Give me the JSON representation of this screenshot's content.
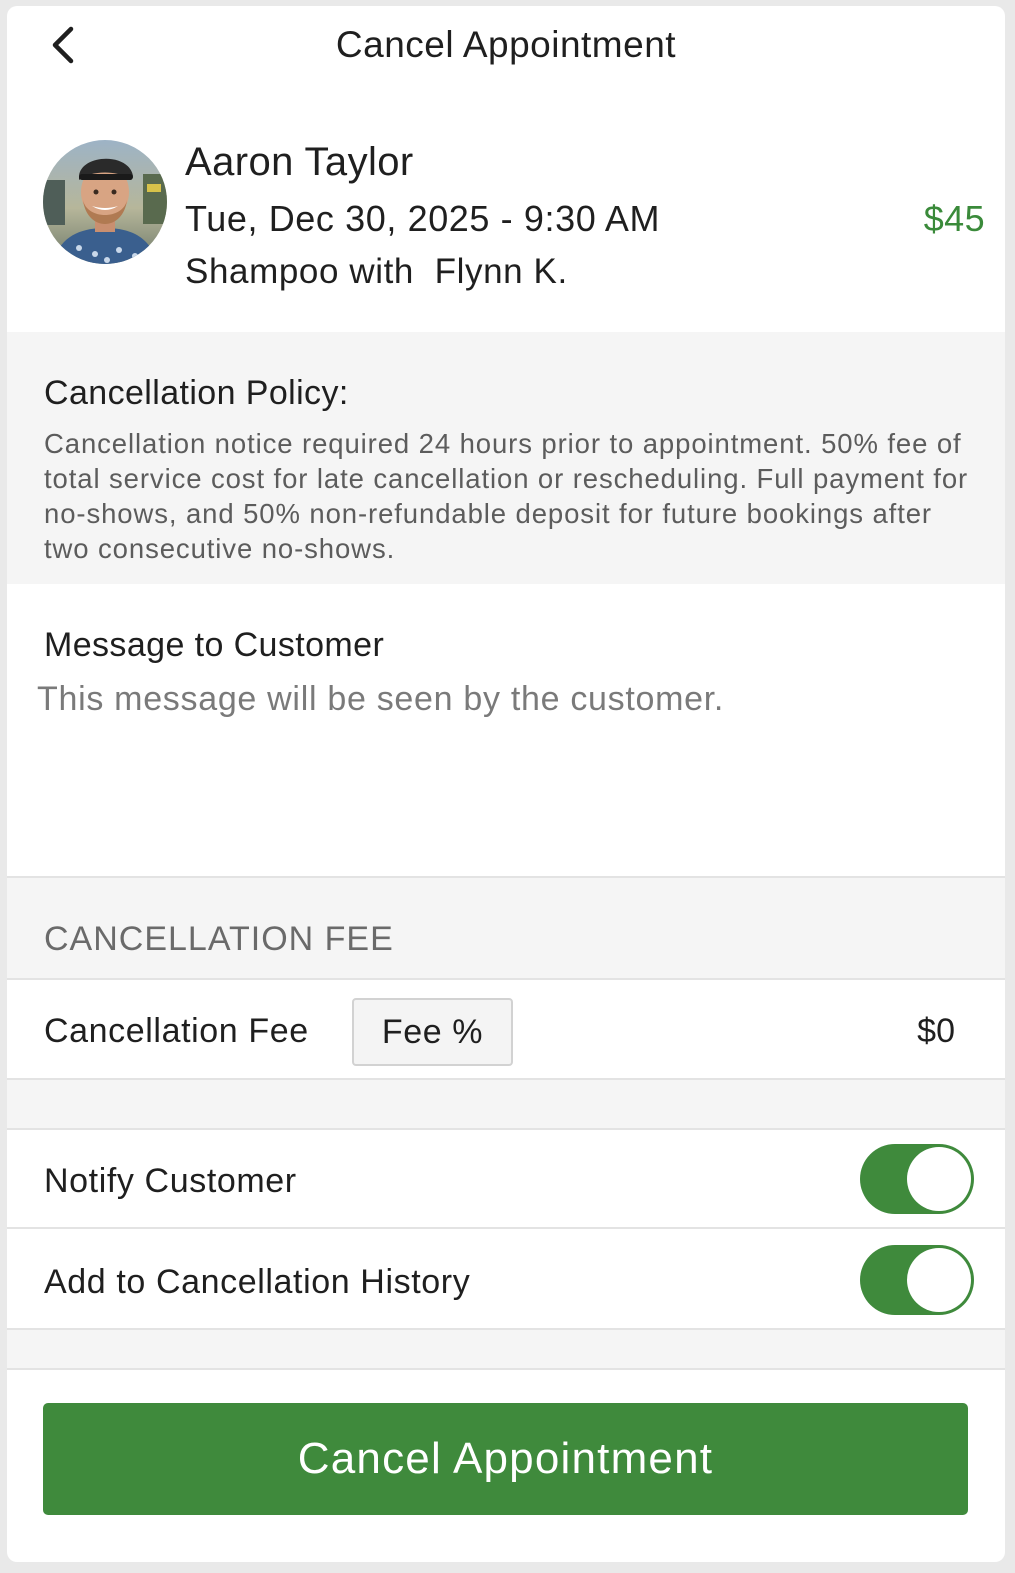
{
  "header": {
    "back_icon": "chevron-left-icon",
    "title": "Cancel Appointment"
  },
  "appointment": {
    "client_name": "Aaron Taylor",
    "datetime": "Tue, Dec 30, 2025 - 9:30 AM",
    "price": "$45",
    "service": "Shampoo with  Flynn K.",
    "avatar": "client-photo"
  },
  "policy": {
    "title": "Cancellation Policy:",
    "text": "Cancellation notice required 24 hours prior to appointment. 50% fee of total service cost for late cancellation or rescheduling. Full payment for no-shows, and 50% non-refundable deposit for future bookings after two consecutive no-shows."
  },
  "message": {
    "title": "Message to Customer",
    "placeholder": "This message will be seen by the customer.",
    "value": ""
  },
  "cancellation_fee": {
    "section_label": "CANCELLATION FEE",
    "row_label": "Cancellation Fee",
    "fee_type_button": "Fee %",
    "amount": "$0"
  },
  "options": {
    "notify_customer": {
      "label": "Notify Customer",
      "on": true
    },
    "add_to_history": {
      "label": "Add to Cancellation History",
      "on": true
    }
  },
  "footer": {
    "submit_label": "Cancel Appointment"
  },
  "colors": {
    "accent_green": "#3f8a3c",
    "price_green": "#3a8a3a"
  }
}
